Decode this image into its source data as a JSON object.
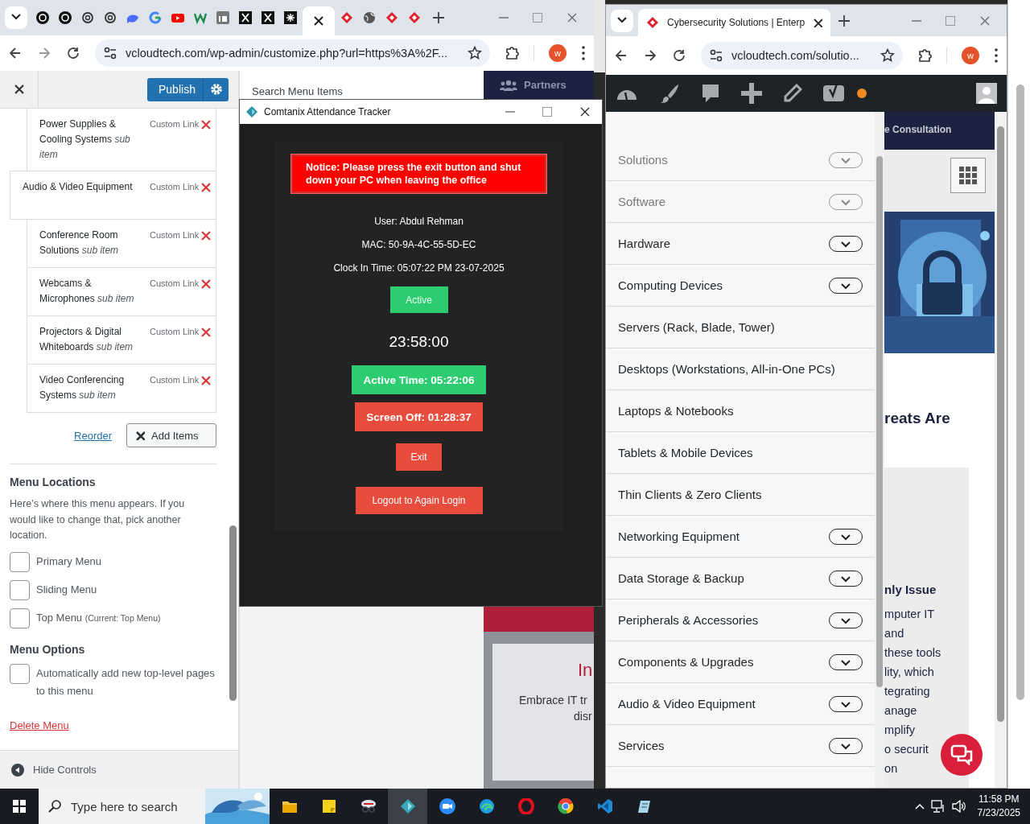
{
  "left_browser": {
    "tabs": [
      {
        "selected": false
      },
      {
        "selected": false
      },
      {
        "selected": false
      },
      {
        "selected": false
      },
      {
        "selected": false
      },
      {
        "selected": false
      },
      {
        "selected": false
      },
      {
        "selected": false
      },
      {
        "selected": false
      },
      {
        "selected": false
      },
      {
        "selected": false
      },
      {
        "selected": false
      },
      {
        "selected": true
      },
      {
        "selected": false
      },
      {
        "selected": false
      },
      {
        "selected": false
      },
      {
        "selected": false
      }
    ],
    "url": "vcloudtech.com/wp-admin/customize.php?url=https%3A%2F...",
    "profile_initial": "w"
  },
  "customizer": {
    "publish": "Publish",
    "menu_items": [
      {
        "title": "Power Supplies & Cooling Systems",
        "type": "Custom Link",
        "note": "sub item",
        "nested": true
      },
      {
        "title": "Audio & Video Equipment",
        "type": "Custom Link",
        "nested": false,
        "children": [
          {
            "title": "Conference Room Solutions",
            "type": "Custom Link",
            "note": "sub item"
          },
          {
            "title": "Webcams & Microphones",
            "type": "Custom Link",
            "note": "sub item"
          },
          {
            "title": "Projectors & Digital Whiteboards",
            "type": "Custom Link",
            "note": "sub item"
          },
          {
            "title": "Video Conferencing Systems",
            "type": "Custom Link",
            "note": "sub item"
          }
        ]
      }
    ],
    "reorder": "Reorder",
    "add_items": "Add Items",
    "locations_title": "Menu Locations",
    "locations_text": "Here’s where this menu appears. If you would like to change that, pick another location.",
    "locations": [
      {
        "label": "Primary Menu",
        "checked": false
      },
      {
        "label": "Sliding Menu",
        "checked": false
      },
      {
        "label": "Top Menu",
        "note": "(Current: Top Menu)",
        "checked": false
      }
    ],
    "options_title": "Menu Options",
    "options": [
      {
        "label": "Automatically add new top-level pages to this menu",
        "checked": false
      }
    ],
    "delete": "Delete Menu",
    "hide_controls": "Hide Controls"
  },
  "preview": {
    "search_label": "Search Menu Items",
    "partners": "Partners",
    "card_title": "In",
    "card_text_1": "Embrace IT tr",
    "card_text_2": "disr"
  },
  "attendance_app": {
    "title": "Comtanix Attendance Tracker",
    "notice": "Notice: Please press the exit button and shut down your PC when leaving the office",
    "user": "User: Abdul Rehman",
    "mac": "MAC: 50-9A-4C-55-5D-EC",
    "clock_in": "Clock In Time: 05:07:22 PM 23-07-2025",
    "status": "Active",
    "clock": "23:58:00",
    "active_time": "Active Time: 05:22:06",
    "screen_off": "Screen Off: 01:28:37",
    "exit": "Exit",
    "logout": "Logout to Again Login"
  },
  "right_browser": {
    "tab_title": "Cybersecurity Solutions | Enterp",
    "url": "vcloudtech.com/solutio...",
    "profile_initial": "w",
    "menu": [
      {
        "label": "Solutions",
        "dimmed": true,
        "expandable": true
      },
      {
        "label": "Software",
        "dimmed": true,
        "expandable": true
      },
      {
        "label": "Hardware",
        "dimmed": false,
        "expandable": true
      },
      {
        "label": "Computing Devices",
        "dimmed": false,
        "expandable": true
      },
      {
        "label": "Servers (Rack, Blade, Tower)",
        "dimmed": false,
        "expandable": false
      },
      {
        "label": "Desktops (Workstations, All-in-One PCs)",
        "dimmed": false,
        "expandable": false
      },
      {
        "label": "Laptops & Notebooks",
        "dimmed": false,
        "expandable": false
      },
      {
        "label": "Tablets & Mobile Devices",
        "dimmed": false,
        "expandable": false
      },
      {
        "label": "Thin Clients & Zero Clients",
        "dimmed": false,
        "expandable": false
      },
      {
        "label": "Networking Equipment",
        "dimmed": false,
        "expandable": true
      },
      {
        "label": "Data Storage & Backup",
        "dimmed": false,
        "expandable": true
      },
      {
        "label": "Peripherals & Accessories",
        "dimmed": false,
        "expandable": true
      },
      {
        "label": "Components & Upgrades",
        "dimmed": false,
        "expandable": true
      },
      {
        "label": "Audio & Video Equipment",
        "dimmed": false,
        "expandable": true
      },
      {
        "label": "Services",
        "dimmed": false,
        "expandable": true
      }
    ],
    "header_button": "e Consultation",
    "heading": "reats Are",
    "card_title": "nly Issue",
    "card_lines": [
      "mputer IT",
      "and",
      "these tools",
      "lity, which",
      "tegrating",
      "anage",
      "mplify",
      "o securit",
      "on"
    ]
  },
  "taskbar": {
    "search_placeholder": "Type here to search",
    "apps": [
      {
        "selected": false
      },
      {
        "selected": false
      },
      {
        "selected": false
      },
      {
        "selected": true
      },
      {
        "selected": false
      },
      {
        "selected": false
      },
      {
        "selected": false
      },
      {
        "selected": false
      },
      {
        "selected": false
      },
      {
        "selected": false
      }
    ],
    "time": "11:58 PM",
    "date": "7/23/2025"
  }
}
